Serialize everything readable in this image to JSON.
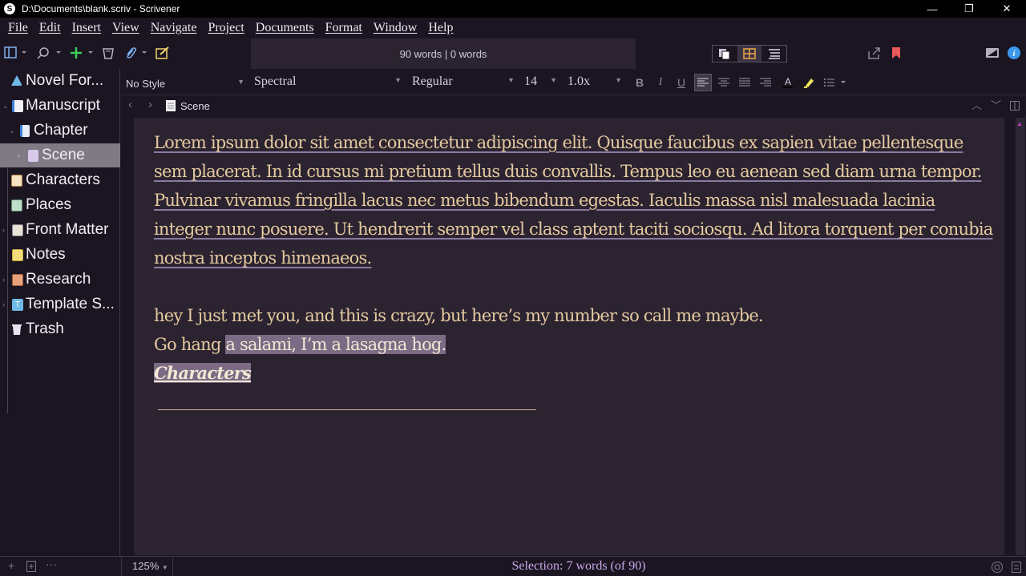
{
  "window": {
    "title": "D:\\Documents\\blank.scriv - Scrivener",
    "minimize": "—",
    "restore": "❐",
    "close": "✕"
  },
  "menu": [
    "File",
    "Edit",
    "Insert",
    "View",
    "Navigate",
    "Project",
    "Documents",
    "Format",
    "Window",
    "Help"
  ],
  "toolbar": {
    "word_count": "90 words | 0 words"
  },
  "binder": {
    "items": [
      {
        "label": "Novel For...",
        "icon": "novel-format-icon"
      },
      {
        "label": "Manuscript",
        "icon": "manuscript-icon"
      },
      {
        "label": "Chapter",
        "icon": "folder-icon"
      },
      {
        "label": "Scene",
        "icon": "document-icon"
      },
      {
        "label": "Characters",
        "icon": "characters-icon"
      },
      {
        "label": "Places",
        "icon": "places-icon"
      },
      {
        "label": "Front Matter",
        "icon": "front-matter-icon"
      },
      {
        "label": "Notes",
        "icon": "notes-icon"
      },
      {
        "label": "Research",
        "icon": "research-icon"
      },
      {
        "label": "Template S...",
        "icon": "template-icon"
      },
      {
        "label": "Trash",
        "icon": "trash-icon"
      }
    ]
  },
  "format_bar": {
    "style": "No Style",
    "font": "Spectral",
    "weight": "Regular",
    "size": "14",
    "line_spacing": "1.0x"
  },
  "header": {
    "doc_title": "Scene"
  },
  "editor": {
    "para1": "Lorem ipsum dolor sit amet consectetur adipiscing elit. Quisque faucibus ex sapien vitae pellentesque sem placerat. In id cursus mi pretium tellus duis convallis. Tempus leo eu aenean sed diam urna tempor. Pulvinar vivamus fringilla lacus nec metus bibendum egestas. Iaculis massa nisl malesuada lacinia integer nunc posuere. Ut hendrerit semper vel class aptent taciti sociosqu. Ad litora torquent per conubia nostra inceptos himenaeos.",
    "line2": "hey I just met you, and this is crazy, but here’s my number so call me maybe.",
    "line3_plain": "Go hang ",
    "line3_selected": "a salami, I’m a lasagna hog.",
    "link_text": "Characters"
  },
  "footer": {
    "zoom": "125%",
    "selection_status": "Selection: 7 words (of 90)"
  },
  "colors": {
    "background": "#1b1522",
    "editor_bg": "#2c2331",
    "text": "#e4ca9e",
    "selection": "#7c6b84",
    "status_text": "#c8a8e8"
  }
}
